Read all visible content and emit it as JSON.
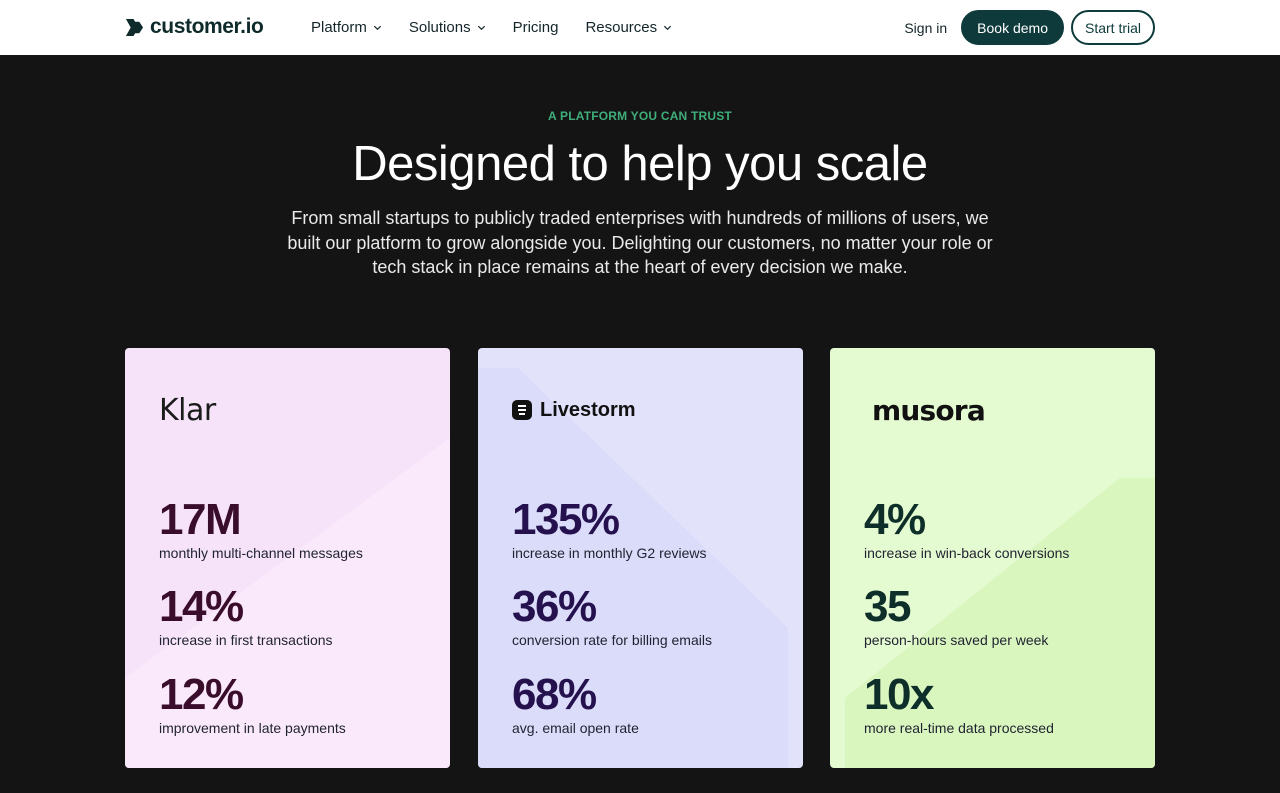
{
  "nav": {
    "logo_text": "customer.io",
    "menu": [
      {
        "label": "Platform",
        "dropdown": true
      },
      {
        "label": "Solutions",
        "dropdown": true
      },
      {
        "label": "Pricing",
        "dropdown": false
      },
      {
        "label": "Resources",
        "dropdown": true
      }
    ],
    "sign_in": "Sign in",
    "book_demo": "Book demo",
    "start_trial": "Start trial"
  },
  "hero": {
    "eyebrow": "A PLATFORM YOU CAN TRUST",
    "title": "Designed to help you scale",
    "subtitle": "From small startups to publicly traded enterprises with hundreds of millions of users, we built our platform to grow alongside you. Delighting our customers, no matter your role or tech stack in place remains at the heart of every decision we make."
  },
  "cards": [
    {
      "brand": "Klar",
      "stats": [
        {
          "value": "17M",
          "label": "monthly multi-channel messages"
        },
        {
          "value": "14%",
          "label": "increase in first transactions"
        },
        {
          "value": "12%",
          "label": "improvement in late payments"
        }
      ]
    },
    {
      "brand": "Livestorm",
      "stats": [
        {
          "value": "135%",
          "label": "increase in monthly G2 reviews"
        },
        {
          "value": "36%",
          "label": "conversion rate for billing emails"
        },
        {
          "value": "68%",
          "label": "avg. email open rate"
        }
      ]
    },
    {
      "brand": "musora",
      "stats": [
        {
          "value": "4%",
          "label": "increase in win-back conversions"
        },
        {
          "value": "35",
          "label": "person-hours saved per week"
        },
        {
          "value": "10x",
          "label": "more real-time data processed"
        }
      ]
    }
  ],
  "colors": {
    "background": "#141414",
    "accent_green": "#3fae7a",
    "brand_teal": "#0e3a3b"
  }
}
